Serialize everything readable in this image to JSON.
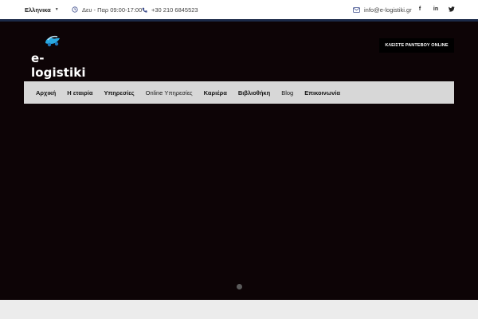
{
  "topbar": {
    "language": "Ελληνικα",
    "hours": "Δευ - Παρ 09:00-17:00",
    "phone": "+30 210 6845523",
    "email": "info@e-logistiki.gr",
    "socials": [
      "f",
      "in",
      "t"
    ]
  },
  "header": {
    "logo_text": "e-logistiki",
    "cta_label": "ΚΛΕΙΣΤΕ ΡΑΝΤΕΒΟΥ ONLINE"
  },
  "nav": {
    "items": [
      "Αρχική",
      "Η εταιρία",
      "Υπηρεσίες",
      "Online Υπηρεσίες",
      "Καριέρα",
      "Βιβλιοθήκη",
      "Blog",
      "Επικοινωνία"
    ]
  },
  "colors": {
    "hero_bg": "#0d0406",
    "topbar_line": "#1b2a48",
    "nav_bg": "#d7d7d7",
    "accent_icon": "#3a4a8a",
    "logo_blue": "#29a9e1"
  },
  "icons": {
    "language_caret": "chevron-down-icon",
    "hours": "clock-icon",
    "phone": "phone-icon",
    "email": "envelope-icon",
    "facebook": "facebook-icon",
    "linkedin": "linkedin-icon",
    "twitter": "twitter-icon"
  }
}
